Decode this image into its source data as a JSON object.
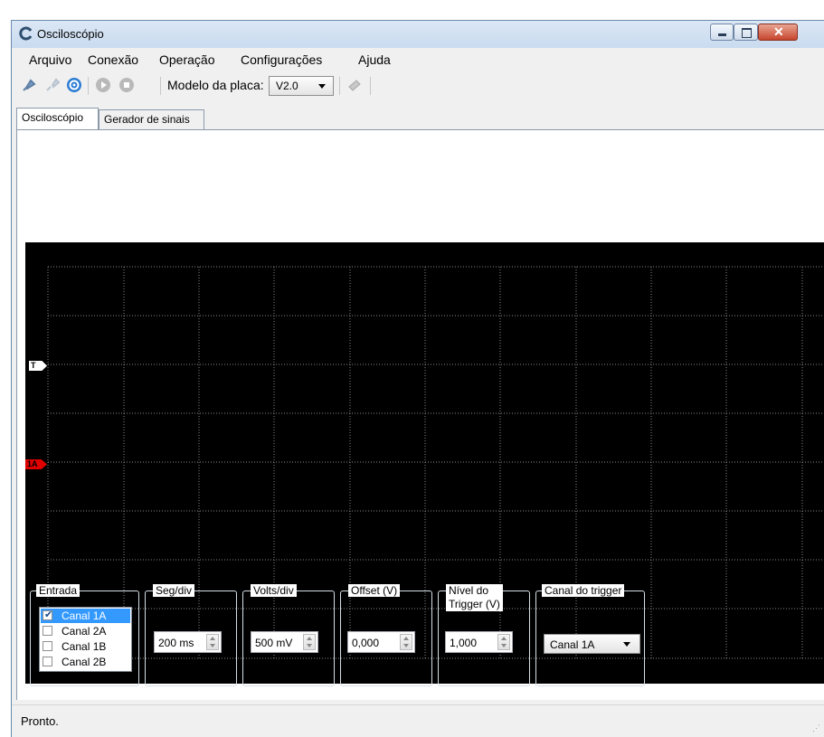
{
  "window": {
    "title": "Osciloscópio"
  },
  "menu": [
    "Arquivo",
    "Conexão",
    "Operação",
    "Configurações",
    "Ajuda"
  ],
  "toolbar": {
    "icons": [
      "connect-icon",
      "disconnect-icon",
      "settings-icon",
      "play-icon",
      "stop-icon",
      "chip-icon"
    ],
    "board_label": "Modelo da placa:",
    "board_value": "V2.0"
  },
  "tabs": [
    "Osciloscópio",
    "Gerador de sinais"
  ],
  "scope": {
    "background": "#000000",
    "grid_color": "#8a8a8a",
    "trigger_marker": "T",
    "channel_marker": "1A",
    "channel_marker_color": "#e00000"
  },
  "controls": {
    "entrada": {
      "title": "Entrada",
      "items": [
        {
          "label": "Canal 1A",
          "checked": true,
          "selected": true
        },
        {
          "label": "Canal 2A",
          "checked": false,
          "selected": false
        },
        {
          "label": "Canal 1B",
          "checked": false,
          "selected": false
        },
        {
          "label": "Canal 2B",
          "checked": false,
          "selected": false
        }
      ]
    },
    "seg_div": {
      "title": "Seg/div",
      "value": "200 ms"
    },
    "volts_div": {
      "title": "Volts/div",
      "value": "500 mV"
    },
    "offset": {
      "title": "Offset (V)",
      "value": "0,000"
    },
    "nivel": {
      "title_line1": "Nível do",
      "title_line2": "Trigger (V)",
      "value": "1,000"
    },
    "canal_trigger": {
      "title": "Canal do trigger",
      "value": "Canal 1A"
    }
  },
  "status": {
    "text": "Pronto."
  }
}
